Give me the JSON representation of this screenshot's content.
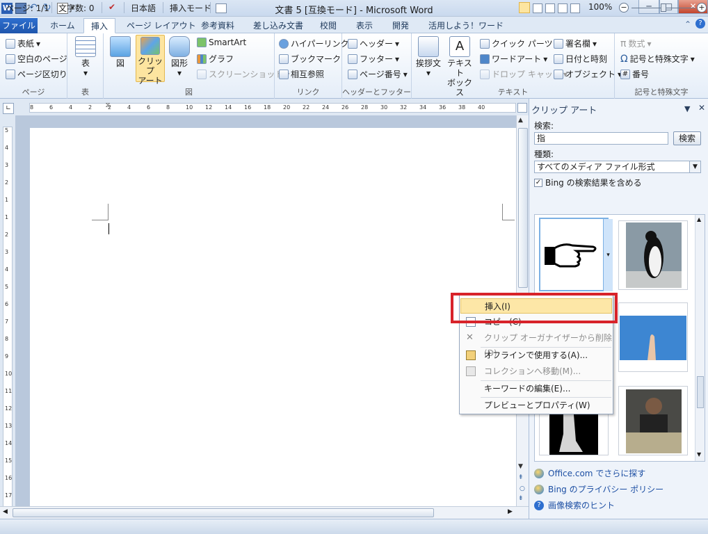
{
  "window": {
    "title": "文書 5 [互換モード] - Microsoft Word",
    "min": "─",
    "max": "□",
    "close": "✕"
  },
  "tabs": [
    "ファイル",
    "ホーム",
    "挿入",
    "ページ レイアウト",
    "参考資料",
    "差し込み文書",
    "校閲",
    "表示",
    "開発",
    "活用しよう！ワード"
  ],
  "ribbon": {
    "pages": {
      "label": "ページ",
      "items": [
        "表紙",
        "空白のページ",
        "ページ区切り"
      ]
    },
    "table": {
      "label": "表",
      "button": "表"
    },
    "illust": {
      "label": "図",
      "picture": "図",
      "clipart": "クリップ\nアート",
      "shapes": "図形",
      "smartart": "SmartArt",
      "chart": "グラフ",
      "screenshot": "スクリーンショット"
    },
    "links": {
      "label": "リンク",
      "items": [
        "ハイパーリンク",
        "ブックマーク",
        "相互参照"
      ]
    },
    "hf": {
      "label": "ヘッダーとフッター",
      "items": [
        "ヘッダー",
        "フッター",
        "ページ番号"
      ]
    },
    "text": {
      "label": "テキスト",
      "greeting": "挨拶文",
      "textbox": "テキスト\nボックス",
      "items": [
        "クイック パーツ",
        "ワードアート",
        "ドロップ キャップ"
      ],
      "items2": [
        "署名欄",
        "日付と時刻",
        "オブジェクト"
      ]
    },
    "symbols": {
      "label": "記号と特殊文字",
      "items": [
        "数式",
        "記号と特殊文字",
        "番号"
      ]
    }
  },
  "pane": {
    "title": "クリップ アート",
    "search_label": "検索:",
    "search_value": "指",
    "search_button": "検索",
    "type_label": "種類:",
    "type_value": "すべてのメディア ファイル形式",
    "bing_checkbox": "Bing の検索結果を含める",
    "links": [
      "Office.com でさらに探す",
      "Bing のプライバシー ポリシー",
      "画像検索のヒント"
    ]
  },
  "context_menu": [
    "挿入(I)",
    "コピー(C)",
    "クリップ オーガナイザーから削除(D)",
    "オフラインで使用する(A)...",
    "コレクションへ移動(M)...",
    "キーワードの編集(E)...",
    "プレビューとプロパティ(W)"
  ],
  "ruler_h": [
    "8",
    "6",
    "4",
    "2",
    "2",
    "4",
    "6",
    "8",
    "10",
    "12",
    "14",
    "16",
    "18",
    "20",
    "22",
    "24",
    "26",
    "28",
    "30",
    "32",
    "34",
    "36",
    "38",
    "40"
  ],
  "ruler_v": [
    "5",
    "4",
    "3",
    "2",
    "1",
    "1",
    "2",
    "3",
    "4",
    "5",
    "6",
    "7",
    "8",
    "9",
    "10",
    "11",
    "12",
    "13",
    "14",
    "15",
    "16",
    "17"
  ],
  "status": {
    "page": "ページ: 1/1",
    "words": "文字数: 0",
    "lang": "日本語",
    "mode": "挿入モード",
    "zoom": "100%"
  }
}
